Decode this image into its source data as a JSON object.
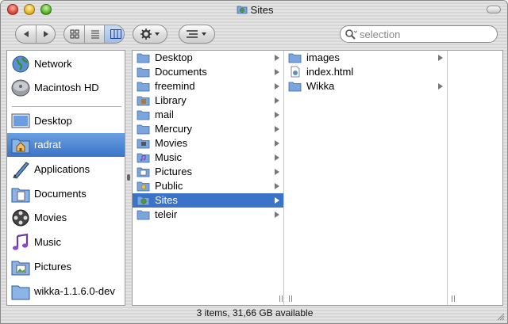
{
  "window": {
    "title": "Sites"
  },
  "toolbar": {
    "search_placeholder": "selection"
  },
  "sidebar": {
    "items": [
      {
        "label": "Network",
        "icon": "globe-icon"
      },
      {
        "label": "Macintosh HD",
        "icon": "hard-drive-icon"
      },
      {
        "label": "Desktop",
        "icon": "desktop-icon"
      },
      {
        "label": "radrat",
        "icon": "home-icon",
        "selected": true
      },
      {
        "label": "Applications",
        "icon": "applications-icon"
      },
      {
        "label": "Documents",
        "icon": "documents-icon"
      },
      {
        "label": "Movies",
        "icon": "movies-icon"
      },
      {
        "label": "Music",
        "icon": "music-icon"
      },
      {
        "label": "Pictures",
        "icon": "pictures-icon"
      },
      {
        "label": "wikka-1.1.6.0-dev",
        "icon": "folder-icon"
      }
    ]
  },
  "columns": {
    "col1": [
      {
        "label": "Desktop"
      },
      {
        "label": "Documents"
      },
      {
        "label": "freemind"
      },
      {
        "label": "Library"
      },
      {
        "label": "mail"
      },
      {
        "label": "Mercury"
      },
      {
        "label": "Movies"
      },
      {
        "label": "Music"
      },
      {
        "label": "Pictures"
      },
      {
        "label": "Public"
      },
      {
        "label": "Sites",
        "selected": true
      },
      {
        "label": "teleir"
      }
    ],
    "col2": [
      {
        "label": "images"
      },
      {
        "label": "index.html"
      },
      {
        "label": "Wikka"
      }
    ]
  },
  "status": {
    "text": "3 items, 31,66 GB available"
  },
  "colors": {
    "selection": "#3a73c8",
    "folder_blue": "#7aa6dd"
  }
}
